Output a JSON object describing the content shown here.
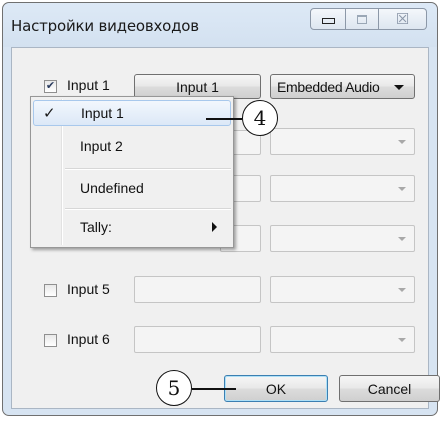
{
  "window": {
    "title": "Настройки видеовходов",
    "close_glyph": "☒"
  },
  "rows": [
    {
      "checked": true,
      "label": "Input 1",
      "button_label": "Input 1",
      "combo_value": "Embedded Audio"
    },
    {
      "checked": false,
      "label": "",
      "button_label": "",
      "combo_value": ""
    },
    {
      "checked": false,
      "label": "",
      "button_label": "",
      "combo_value": ""
    },
    {
      "checked": false,
      "label": "",
      "button_label": "",
      "combo_value": ""
    },
    {
      "checked": false,
      "label": "Input 5",
      "button_label": "",
      "combo_value": ""
    },
    {
      "checked": false,
      "label": "Input 6",
      "button_label": "",
      "combo_value": ""
    }
  ],
  "menu": {
    "items": [
      {
        "label": "Input 1",
        "checked": true,
        "highlighted": true
      },
      {
        "label": "Input 2",
        "checked": false
      },
      {
        "label": "Undefined",
        "checked": false
      },
      {
        "label": "Tally:",
        "checked": false,
        "submenu": true
      }
    ],
    "check_glyph": "✓"
  },
  "footer": {
    "ok_label": "OK",
    "cancel_label": "Cancel"
  },
  "callouts": {
    "menu_callout": "4",
    "ok_callout": "5"
  }
}
